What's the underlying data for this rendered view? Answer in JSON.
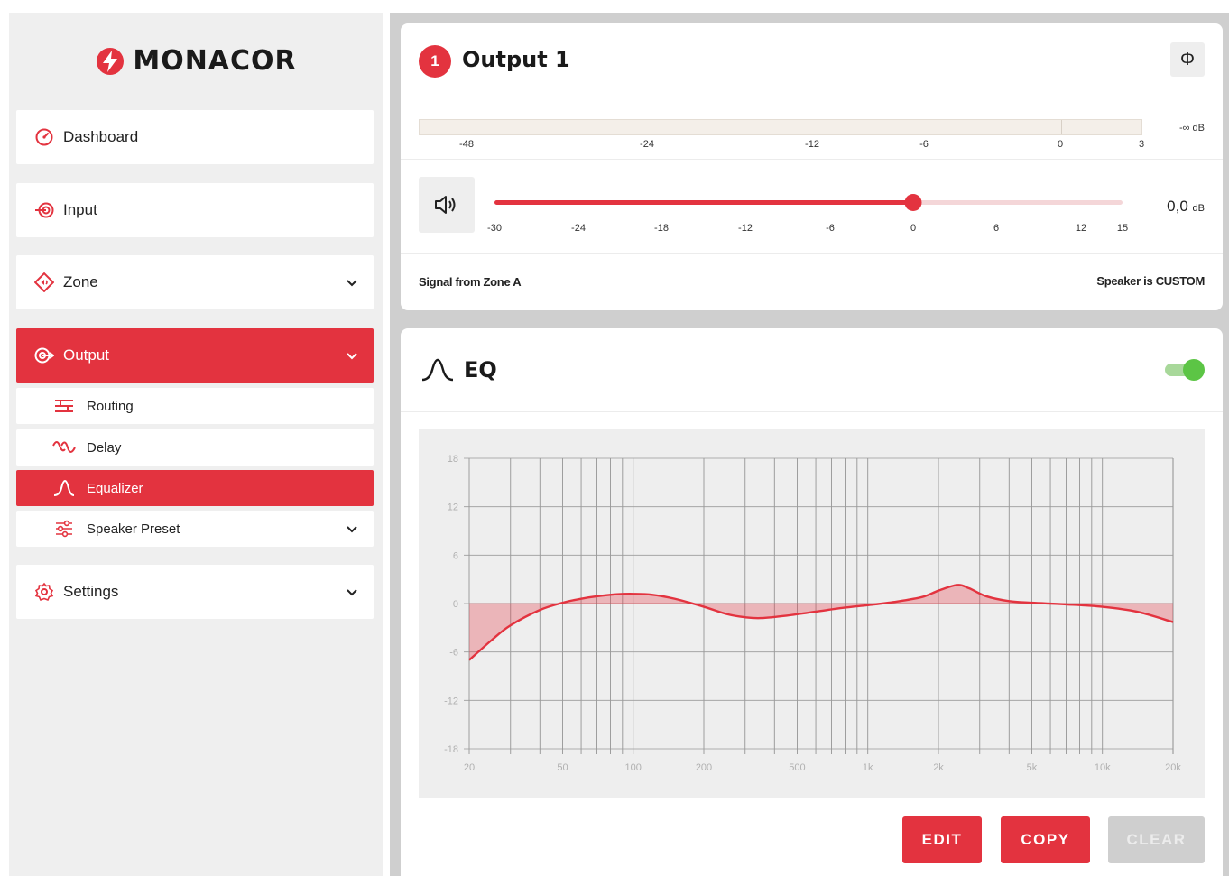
{
  "brand": {
    "name": "MONACOR",
    "color": "#e3333f"
  },
  "sidebar": {
    "items": [
      {
        "label": "Dashboard",
        "icon": "gauge-icon"
      },
      {
        "label": "Input",
        "icon": "input-icon"
      },
      {
        "label": "Zone",
        "icon": "zone-icon"
      },
      {
        "label": "Output",
        "icon": "output-icon",
        "active": true
      },
      {
        "label": "Routing",
        "icon": "routing-icon"
      },
      {
        "label": "Delay",
        "icon": "delay-icon"
      },
      {
        "label": "Equalizer",
        "icon": "equalizer-icon",
        "active": true
      },
      {
        "label": "Speaker Preset",
        "icon": "sliders-icon"
      },
      {
        "label": "Settings",
        "icon": "gear-icon"
      }
    ]
  },
  "output": {
    "badge": "1",
    "title": "Output 1",
    "phase_symbol": "Φ",
    "meter": {
      "ticks": [
        "-48",
        "-24",
        "-12",
        "-6",
        "0",
        "3"
      ],
      "readout_value": "-∞",
      "readout_unit": "dB"
    },
    "gain": {
      "ticks": [
        "-30",
        "-24",
        "-18",
        "-12",
        "-6",
        "0",
        "6",
        "12",
        "15"
      ],
      "min": -30,
      "max": 15,
      "value": 0,
      "value_text": "0,0",
      "unit": "dB"
    },
    "signal_text": "Signal from Zone A",
    "speaker_text": "Speaker is CUSTOM"
  },
  "eq": {
    "title": "EQ",
    "enabled": true,
    "toggle_color": "#5cc545",
    "buttons": {
      "edit": "EDIT",
      "copy": "COPY",
      "clear": "CLEAR"
    }
  },
  "chart_data": {
    "type": "area",
    "x_scale": "log",
    "xlim": [
      20,
      20000
    ],
    "ylim": [
      -18,
      18
    ],
    "y_ticks": [
      "18",
      "12",
      "6",
      "0",
      "-6",
      "-12",
      "-18"
    ],
    "x_tick_labels": [
      "20",
      "50",
      "100",
      "200",
      "500",
      "1k",
      "2k",
      "5k",
      "10k",
      "20k"
    ],
    "x_tick_values": [
      20,
      50,
      100,
      200,
      500,
      1000,
      2000,
      5000,
      10000,
      20000
    ],
    "grid": true,
    "series": [
      {
        "color": "#e3333f",
        "points": [
          [
            20,
            -7
          ],
          [
            25,
            -4.5
          ],
          [
            30,
            -2.7
          ],
          [
            40,
            -0.8
          ],
          [
            50,
            0.1
          ],
          [
            60,
            0.6
          ],
          [
            70,
            0.9
          ],
          [
            85,
            1.15
          ],
          [
            100,
            1.2
          ],
          [
            120,
            1.1
          ],
          [
            150,
            0.6
          ],
          [
            200,
            -0.4
          ],
          [
            250,
            -1.3
          ],
          [
            300,
            -1.7
          ],
          [
            350,
            -1.8
          ],
          [
            450,
            -1.5
          ],
          [
            600,
            -1.0
          ],
          [
            800,
            -0.5
          ],
          [
            1000,
            -0.2
          ],
          [
            1300,
            0.2
          ],
          [
            1700,
            0.8
          ],
          [
            2000,
            1.6
          ],
          [
            2400,
            2.3
          ],
          [
            2700,
            1.9
          ],
          [
            3200,
            0.9
          ],
          [
            4000,
            0.3
          ],
          [
            5000,
            0.1
          ],
          [
            7000,
            -0.1
          ],
          [
            10000,
            -0.4
          ],
          [
            14000,
            -1.0
          ],
          [
            20000,
            -2.3
          ]
        ]
      }
    ]
  }
}
